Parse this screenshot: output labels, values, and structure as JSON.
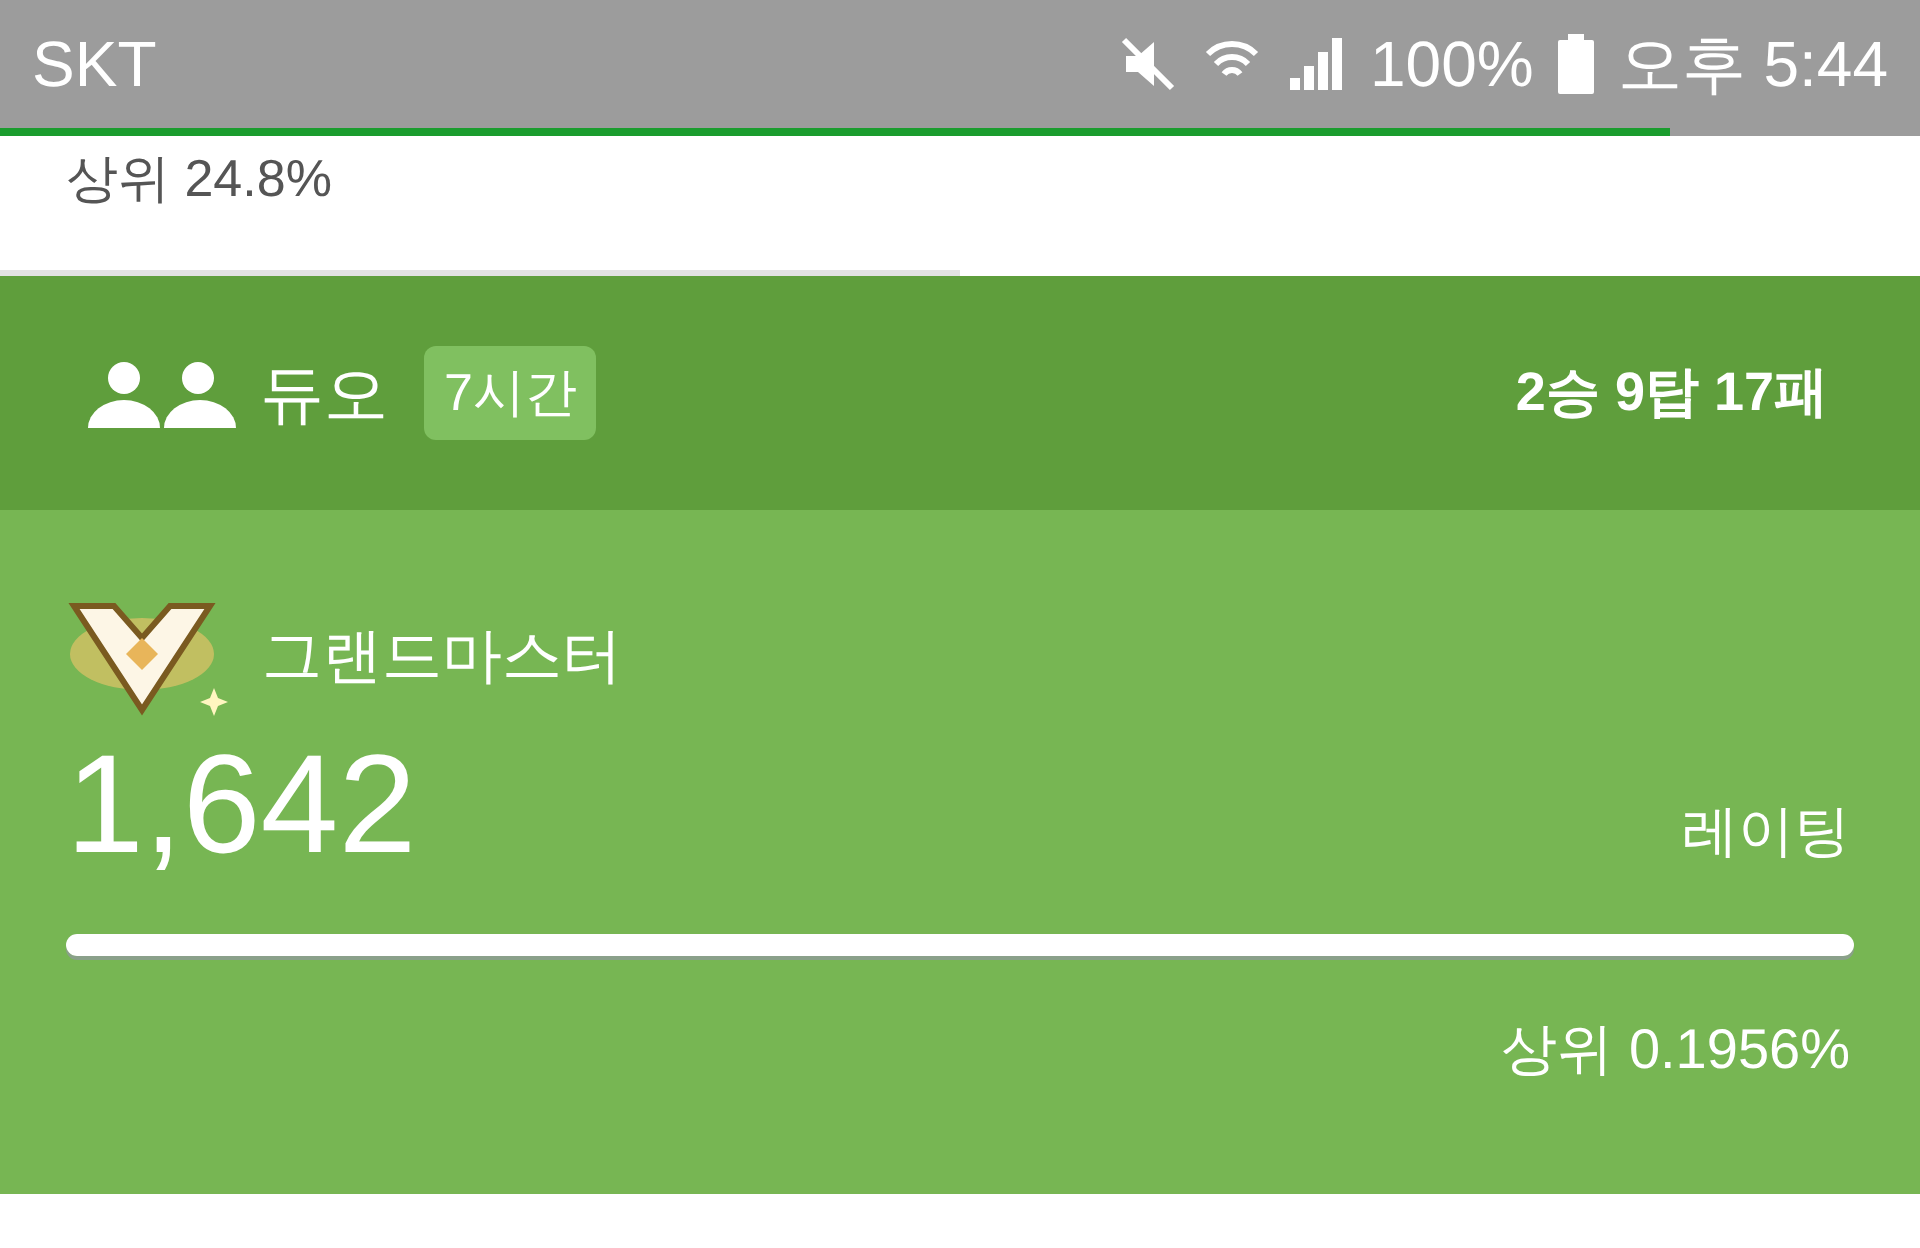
{
  "status_bar": {
    "carrier": "SKT",
    "battery": "100%",
    "time": "오후 5:44"
  },
  "page_progress": {
    "level": 0.87
  },
  "previous_card": {
    "percentile": "상위 24.8%",
    "bar": {
      "level": 0.5
    }
  },
  "mode_header": {
    "title": "듀오",
    "playtime": "7시간",
    "record": "2승 9탑 17패"
  },
  "rank": {
    "tier": "그랜드마스터",
    "rating": "1,642",
    "rating_label": "레이팅",
    "bar": {
      "level": 1
    },
    "percentile": "상위 0.1956%"
  }
}
